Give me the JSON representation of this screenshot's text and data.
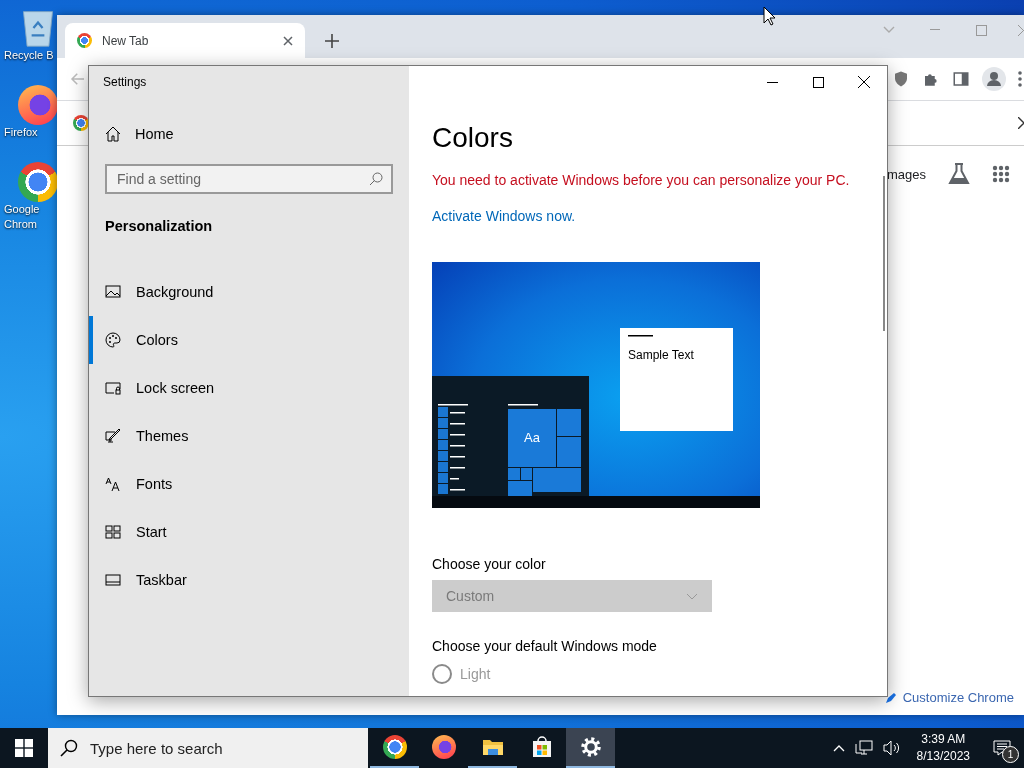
{
  "desktop_icons": [
    {
      "label": "Recycle B",
      "kind": "bin"
    },
    {
      "label": "Firefox",
      "kind": "firefox"
    },
    {
      "label": "Google Chrom",
      "kind": "chrome"
    }
  ],
  "browser": {
    "tabs": [
      {
        "title": "New Tab",
        "selected": true
      }
    ],
    "shortcut_label": "mages",
    "customize_button": "Customize Chrome"
  },
  "settings": {
    "title": "Settings",
    "home": "Home",
    "search": {
      "placeholder": "Find a setting"
    },
    "section": "Personalization",
    "nav": [
      {
        "label": "Background",
        "selected": false
      },
      {
        "label": "Colors",
        "selected": true
      },
      {
        "label": "Lock screen",
        "selected": false
      },
      {
        "label": "Themes",
        "selected": false
      },
      {
        "label": "Fonts",
        "selected": false
      },
      {
        "label": "Start",
        "selected": false
      },
      {
        "label": "Taskbar",
        "selected": false
      }
    ],
    "page_title": "Colors",
    "warning": "You need to activate Windows before you can personalize your PC.",
    "activate_link": "Activate Windows now.",
    "preview": {
      "sample_text": "Sample Text",
      "tile_text": "Aa"
    },
    "color_label": "Choose your color",
    "color_dropdown": {
      "value": "Custom",
      "disabled": true
    },
    "mode_label": "Choose your default Windows mode",
    "mode_options": [
      {
        "label": "Light",
        "selected": false
      }
    ]
  },
  "taskbar": {
    "search": {
      "placeholder": "Type here to search"
    },
    "apps": [
      {
        "kind": "chrome",
        "running": true,
        "selected": false
      },
      {
        "kind": "firefox",
        "running": false,
        "selected": false
      },
      {
        "kind": "files",
        "running": true,
        "selected": false
      },
      {
        "kind": "store",
        "running": false,
        "selected": false
      },
      {
        "kind": "settings",
        "running": true,
        "selected": true
      }
    ],
    "time": "3:39 AM",
    "date": "8/13/2023",
    "notifications": "1"
  }
}
